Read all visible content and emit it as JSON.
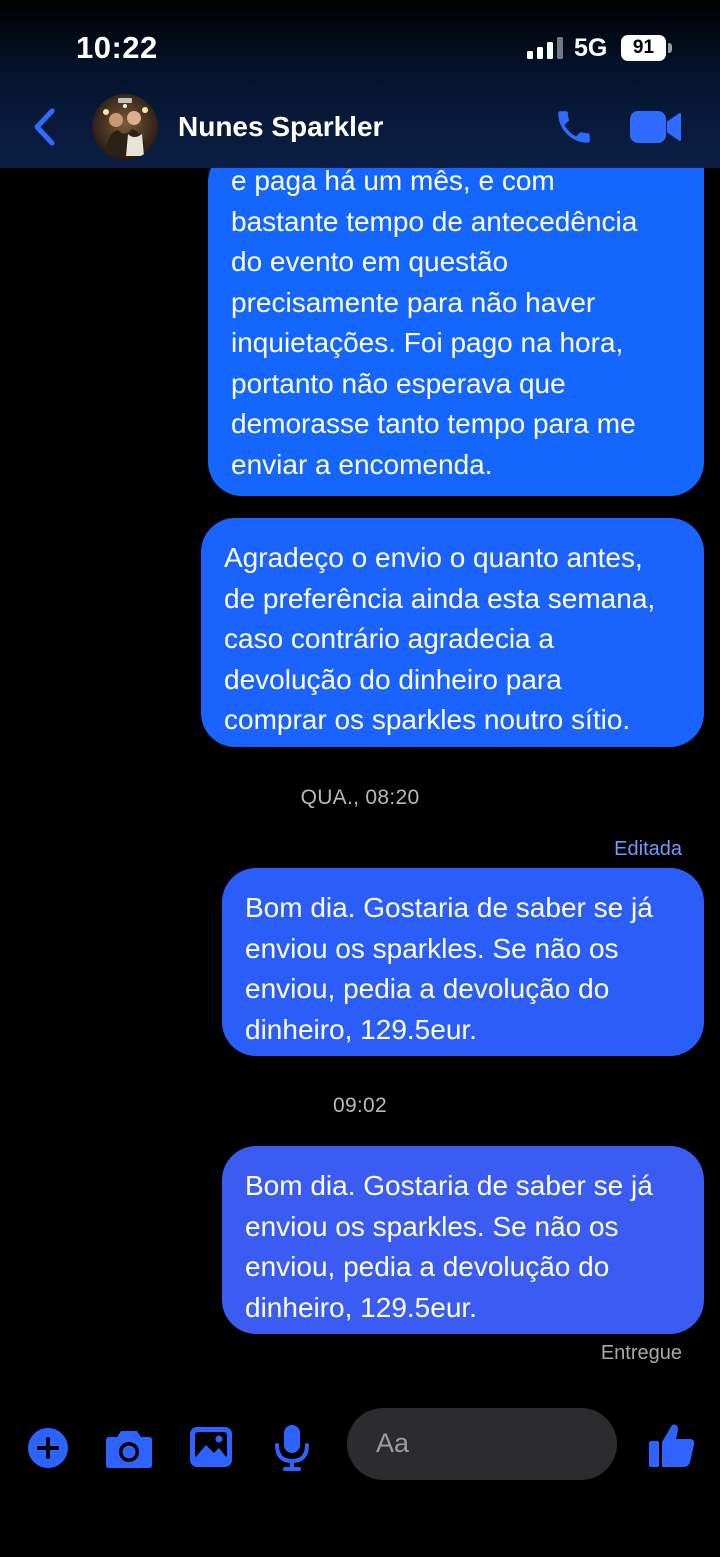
{
  "status_bar": {
    "time": "10:22",
    "network": "5G",
    "battery": "91"
  },
  "header": {
    "contact_name": "Nunes Sparkler"
  },
  "messages": [
    {
      "id": "m1",
      "sender": "me",
      "text": "e paga há um mês, e com\nbastante tempo de antecedência\ndo evento em questão\nprecisamente para não haver\ninquietações. Foi pago na hora,\nportanto não esperava que\ndemorasse tanto tempo para me\nenviar a encomenda."
    },
    {
      "id": "m2",
      "sender": "me",
      "text": "Agradeço o envio o quanto antes,\nde preferência ainda esta semana,\ncaso contrário agradecia a\ndevolução do dinheiro para\ncomprar os sparkles noutro sítio."
    },
    {
      "id": "m3",
      "sender": "me",
      "text": "Bom dia. Gostaria de saber se já\nenviou os sparkles. Se não os\nenviou, pedia a devolução do\ndinheiro, 129.5eur."
    },
    {
      "id": "m4",
      "sender": "me",
      "text": "Bom dia. Gostaria de saber se já\nenviou os sparkles. Se não os\nenviou, pedia a devolução do\ndinheiro, 129.5eur."
    }
  ],
  "timestamps": {
    "t1": "QUA., 08:20",
    "t2": "09:02"
  },
  "labels": {
    "edited": "Editada",
    "delivered": "Entregue"
  },
  "composer": {
    "placeholder": "Aa"
  },
  "colors": {
    "accent": "#2f63ff",
    "bubble_top": "#1466ff",
    "bubble_bottom": "#3a5cf2"
  }
}
